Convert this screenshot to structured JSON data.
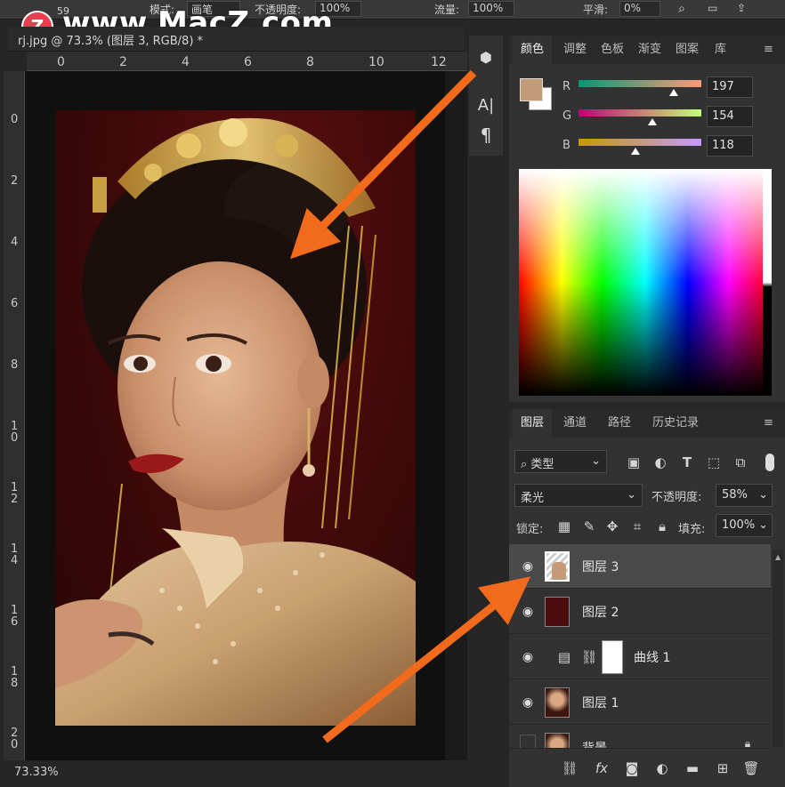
{
  "watermark": {
    "logo_letter": "Z",
    "text": "www.MacZ.com",
    "brush_size": "59"
  },
  "options_bar": {
    "mode_label": "模式:",
    "mode_value": "画笔",
    "opacity_label": "不透明度:",
    "opacity_value": "100%",
    "flow_label": "流量:",
    "flow_value": "100%",
    "smooth_label": "平滑:",
    "smooth_value": "0%"
  },
  "document": {
    "tab_title": "rj.jpg @ 73.3% (图层 3, RGB/8) *",
    "zoom_readout": "73.33%"
  },
  "rulers": {
    "horizontal_ticks": [
      "0",
      "2",
      "4",
      "6",
      "8",
      "10",
      "12"
    ],
    "vertical_ticks": [
      "0",
      "2",
      "4",
      "6",
      "8",
      "10",
      "12",
      "14",
      "16",
      "18",
      "20"
    ]
  },
  "tool_strip": {
    "icons": [
      "3d-cube-icon",
      "character-icon",
      "paragraph-icon"
    ],
    "character_glyph": "A|",
    "paragraph_glyph": "¶"
  },
  "color_panel": {
    "tabs": [
      "颜色",
      "调整",
      "色板",
      "渐变",
      "图案",
      "库"
    ],
    "active_tab": "颜色",
    "foreground_color": "#c59a76",
    "background_color": "#ffffff",
    "channels": [
      {
        "label": "R",
        "value": "197",
        "fraction": 0.773
      },
      {
        "label": "G",
        "value": "154",
        "fraction": 0.604
      },
      {
        "label": "B",
        "value": "118",
        "fraction": 0.463
      }
    ]
  },
  "layers_panel": {
    "tabs": [
      "图层",
      "通道",
      "路径",
      "历史记录"
    ],
    "active_tab": "图层",
    "filter_kind": "类型",
    "blend_mode": "柔光",
    "opacity_label": "不透明度:",
    "opacity_value": "58%",
    "lock_label": "锁定:",
    "fill_label": "填充:",
    "fill_value": "100%",
    "layers": [
      {
        "name": "图层 3",
        "selected": true,
        "visible": true,
        "thumb": "transparent-skin"
      },
      {
        "name": "图层 2",
        "selected": false,
        "visible": true,
        "thumb": "dark-red"
      },
      {
        "name": "曲线 1",
        "selected": false,
        "visible": true,
        "thumb": "curves-adjustment"
      },
      {
        "name": "图层 1",
        "selected": false,
        "visible": true,
        "thumb": "portrait"
      },
      {
        "name": "背景",
        "selected": false,
        "visible": false,
        "thumb": "portrait",
        "locked": true
      }
    ]
  },
  "colors": {
    "arrow": "#f26a1b",
    "panel": "#323232",
    "canvas_bg": "#5a0e0e"
  }
}
